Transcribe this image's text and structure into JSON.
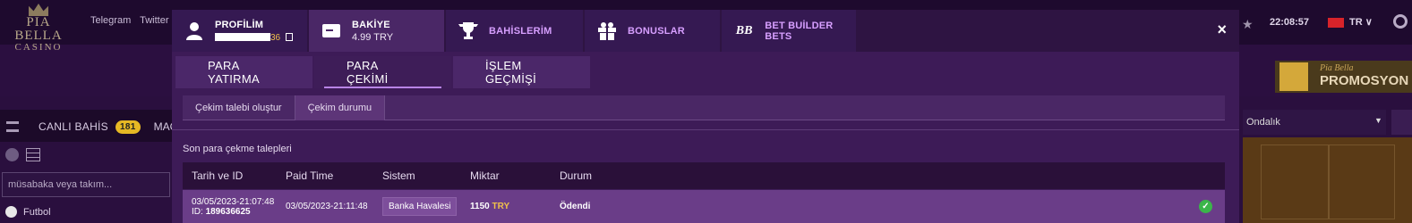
{
  "site": {
    "logo_line1": "PIA BELLA",
    "logo_line2": "CASINO",
    "links": [
      "Telegram",
      "Twitter"
    ],
    "live_label": "CANLI BAHİS",
    "live_count": "181",
    "mac_label": "MAÇ",
    "search_placeholder": "müsabaka veya takım...",
    "sport_label": "Futbol",
    "time": "22:08:57",
    "lang": "TR",
    "promo_small": "Pia Bella",
    "promo_big": "PROMOSYON",
    "odds_label": "Ondalık"
  },
  "modal": {
    "tabs": [
      {
        "title": "PROFİLİM",
        "sub_suffix": "36"
      },
      {
        "title": "BAKİYE",
        "sub": "4.99 TRY"
      },
      {
        "title": "BAHİSLERİM"
      },
      {
        "title": "BONUSLAR"
      },
      {
        "title": "BET BUİLDER BETS"
      }
    ],
    "close": "×",
    "subtabs": [
      "PARA YATIRMA",
      "PARA ÇEKİMİ",
      "İŞLEM GEÇMİŞİ"
    ],
    "thirdtabs": [
      "Çekim talebi oluştur",
      "Çekim durumu"
    ],
    "section_title": "Son para çekme talepleri",
    "table": {
      "headers": [
        "Tarih ve ID",
        "Paid Time",
        "Sistem",
        "Miktar",
        "Durum"
      ],
      "rows": [
        {
          "date": "03/05/2023-21:07:48",
          "id_label": "ID:",
          "id": "189636625",
          "paid_time": "03/05/2023-21:11:48",
          "system": "Banka Havalesi",
          "amount": "1150",
          "currency": "TRY",
          "status": "Ödendi"
        }
      ]
    }
  },
  "colors": {
    "accent": "#b884e6",
    "modal_bg": "#3d1b57",
    "row_bg": "#6a3d88",
    "status_ok": "#3bb54a",
    "currency": "#f0c04a"
  }
}
